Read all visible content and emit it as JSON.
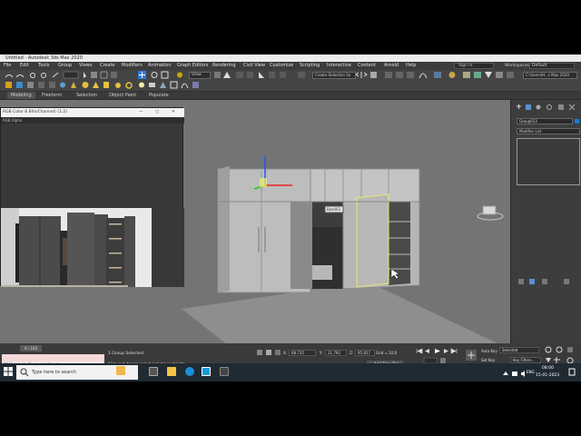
{
  "window": {
    "title": "Untitled - Autodesk 3ds Max 2020"
  },
  "menu": {
    "items": [
      "File",
      "Edit",
      "Tools",
      "Group",
      "Views",
      "Create",
      "Modifiers",
      "Animation",
      "Graph Editors",
      "Rendering",
      "Civil View",
      "Customize",
      "Scripting",
      "Interactive",
      "Content",
      "Arnold",
      "Help"
    ],
    "signin": "Sign In",
    "workspaces_label": "Workspaces:",
    "workspace": "Default"
  },
  "toolbar": {
    "view_dropdown": "View",
    "selection_set": "Create Selection Se",
    "user_path": "C:\\Users\\H...s Max 2020"
  },
  "ribbon": {
    "tabs": [
      "Modeling",
      "Freeform",
      "Selection",
      "Object Paint",
      "Populate"
    ]
  },
  "image_window": {
    "title": "RGB Color 8 Bits/Channel) (1:2)",
    "channel": "RGB Alpha"
  },
  "viewport": {
    "tooltip": "Box003"
  },
  "command_panel": {
    "object_name": "Group013",
    "modifier_list": "Modifier List",
    "object_color": "#1a7ad4"
  },
  "status": {
    "frame": "0 / 100",
    "maxscript_hint": "MAXScript Mini Listener",
    "selection": "1 Group Selected",
    "prompt": "Click and drag to select and move objects",
    "x_label": "X:",
    "x": "68.735",
    "y_label": "Y:",
    "y": "21.792",
    "z_label": "Z:",
    "z": "95.827",
    "grid": "Grid = 10.0",
    "add_time_tag": "Add Time Tag",
    "auto_key": "Auto Key",
    "set_key": "Set Key",
    "selected": "Selected",
    "key_filters": "Key Filters..."
  },
  "taskbar": {
    "search_placeholder": "Type here to search",
    "lang": "ENG",
    "time": "08:00",
    "date": "15-01-2023"
  }
}
